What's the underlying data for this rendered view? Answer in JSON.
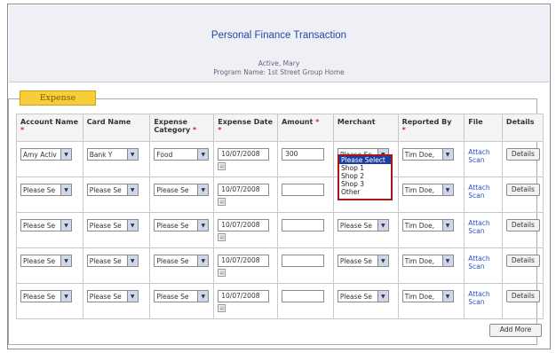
{
  "page": {
    "title": "Personal Finance Transaction",
    "status_line": "Active, Mary",
    "program_line": "Program Name: 1st Street Group Home"
  },
  "section": {
    "tab_label": "Expense"
  },
  "columns": {
    "account_name": "Account Name",
    "card_name": "Card Name",
    "expense_category": "Expense Category",
    "expense_date": "Expense Date",
    "amount": "Amount",
    "merchant": "Merchant",
    "reported_by": "Reported By",
    "file": "File",
    "details": "Details",
    "required_mark": "*"
  },
  "rows": [
    {
      "account": "Amy Activ",
      "card": "Bank Y",
      "category": "Food",
      "date": "10/07/2008",
      "amount": "300",
      "merchant": "Please Se",
      "reported": "Tim Doe, ",
      "file": "Attach Scan",
      "details": "Details"
    },
    {
      "account": "Please Se",
      "card": "Please Se",
      "category": "Please Se",
      "date": "10/07/2008",
      "amount": "",
      "merchant": "",
      "reported": "Tim Doe, ",
      "file": "Attach Scan",
      "details": "Details"
    },
    {
      "account": "Please Se",
      "card": "Please Se",
      "category": "Please Se",
      "date": "10/07/2008",
      "amount": "",
      "merchant": "Please Se",
      "reported": "Tim Doe, ",
      "file": "Attach Scan",
      "details": "Details"
    },
    {
      "account": "Please Se",
      "card": "Please Se",
      "category": "Please Se",
      "date": "10/07/2008",
      "amount": "",
      "merchant": "Please Se",
      "reported": "Tim Doe, ",
      "file": "Attach Scan",
      "details": "Details"
    },
    {
      "account": "Please Se",
      "card": "Please Se",
      "category": "Please Se",
      "date": "10/07/2008",
      "amount": "",
      "merchant": "Please Se",
      "reported": "Tim Doe, ",
      "file": "Attach Scan",
      "details": "Details"
    }
  ],
  "merchant_dropdown": {
    "options": [
      "Please Select",
      "Shop 1",
      "Shop 2",
      "Shop 3",
      "Other"
    ],
    "highlighted": "Please Select"
  },
  "buttons": {
    "add_more": "Add More"
  },
  "colors": {
    "title": "#2446a4",
    "tab": "#f6ce3c",
    "link": "#2850c8",
    "dropdown_border": "#a31818",
    "highlight": "#1b3fa3"
  }
}
